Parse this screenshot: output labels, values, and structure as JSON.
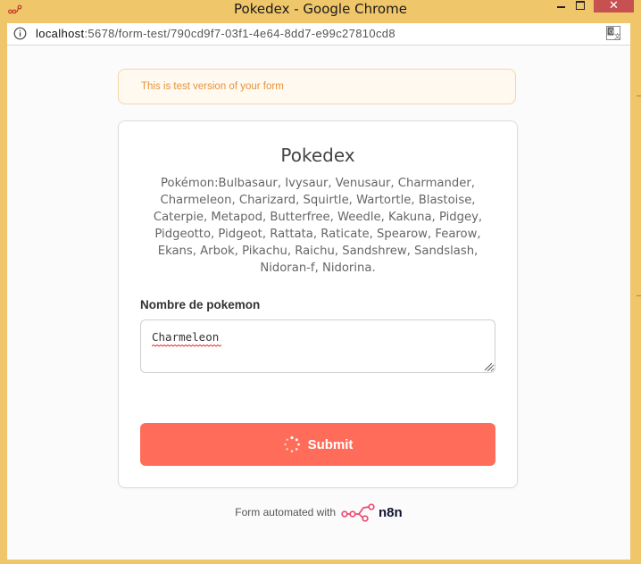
{
  "window": {
    "title": "Pokedex - Google Chrome"
  },
  "addressbar": {
    "host": "localhost",
    "path": ":5678/form-test/790cd9f7-03f1-4e64-8dd7-e99c27810cd8"
  },
  "banner": {
    "text": "This is test version of your form"
  },
  "form": {
    "title": "Pokedex",
    "description": "Pokémon:Bulbasaur, Ivysaur, Venusaur, Charmander, Charmeleon, Charizard, Squirtle, Wartortle, Blastoise, Caterpie, Metapod, Butterfree, Weedle, Kakuna, Pidgey, Pidgeotto, Pidgeot, Rattata, Raticate, Spearow, Fearow, Ekans, Arbok, Pikachu, Raichu, Sandshrew, Sandslash, Nidoran-f, Nidorina.",
    "field_label": "Nombre de pokemon",
    "field_value": "Charmeleon",
    "submit_label": "Submit"
  },
  "footer": {
    "text": "Form automated with",
    "brand": "n8n"
  },
  "colors": {
    "titlebar": "#f0c66a",
    "accent": "#ff6d5a",
    "banner_text": "#e8923c",
    "close_button": "#c75050"
  },
  "icons": {
    "app": "n8n-logo-icon",
    "info": "info-icon",
    "translate": "translate-icon",
    "spinner": "spinner-icon",
    "brand": "n8n-logo-icon"
  }
}
